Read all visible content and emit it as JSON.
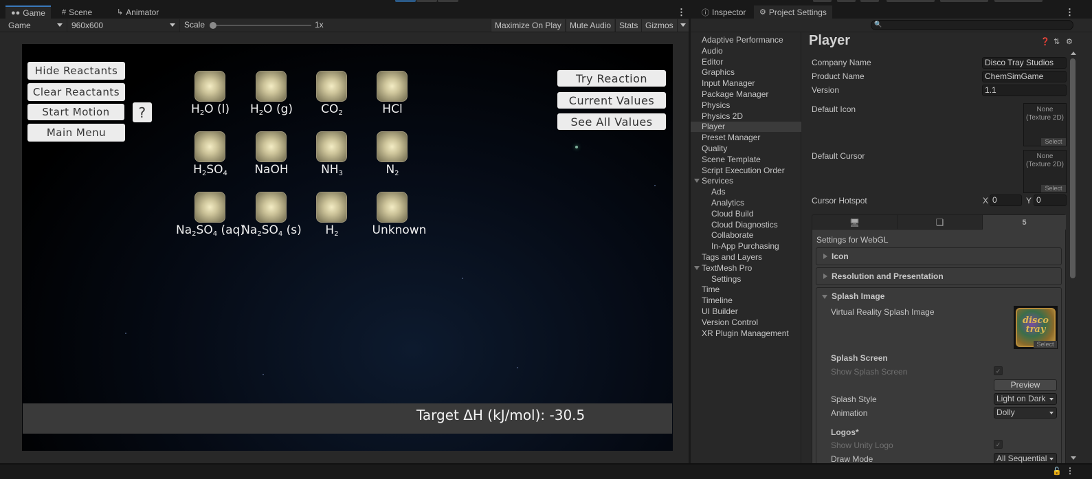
{
  "game_tabs": [
    {
      "label": "Game",
      "icon": "gamepad-icon",
      "active": true
    },
    {
      "label": "Scene",
      "icon": "grid-icon",
      "active": false
    },
    {
      "label": "Animator",
      "icon": "animator-icon",
      "active": false
    }
  ],
  "game_toolbar": {
    "display": "Game",
    "resolution": "960x600",
    "scale_label": "Scale",
    "scale_value": "1x",
    "maximize_on_play": "Maximize On Play",
    "mute_audio": "Mute Audio",
    "stats": "Stats",
    "gizmos": "Gizmos"
  },
  "game": {
    "left_buttons": [
      "Hide Reactants",
      "Clear Reactants",
      "Start Motion",
      "Main Menu"
    ],
    "help_button": "?",
    "right_buttons": [
      "Try Reaction",
      "Current Values",
      "See All Values"
    ],
    "reactants": [
      {
        "formula": "H|2|O (l)"
      },
      {
        "formula": "H|2|O (g)"
      },
      {
        "formula": "CO|2|"
      },
      {
        "formula": "HCl"
      },
      {
        "formula": "H|2|SO|4|"
      },
      {
        "formula": "NaOH"
      },
      {
        "formula": "NH|3|"
      },
      {
        "formula": "N|2|"
      },
      {
        "formula": "Na|2|SO|4| (aq)"
      },
      {
        "formula": "Na|2|SO|4| (s)"
      },
      {
        "formula": "H|2|"
      },
      {
        "formula": "Unknown"
      }
    ],
    "target_label": "Target ΔH (kJ/mol): -30.5"
  },
  "right_tabs": [
    {
      "label": "Inspector",
      "icon": "info-icon",
      "active": false
    },
    {
      "label": "Project Settings",
      "icon": "gear-icon",
      "active": true
    }
  ],
  "project_settings": {
    "search_placeholder": "",
    "nav": [
      {
        "label": "Adaptive Performance",
        "level": 0
      },
      {
        "label": "Audio",
        "level": 0
      },
      {
        "label": "Editor",
        "level": 0
      },
      {
        "label": "Graphics",
        "level": 0
      },
      {
        "label": "Input Manager",
        "level": 0
      },
      {
        "label": "Package Manager",
        "level": 0
      },
      {
        "label": "Physics",
        "level": 0
      },
      {
        "label": "Physics 2D",
        "level": 0
      },
      {
        "label": "Player",
        "level": 0,
        "selected": true
      },
      {
        "label": "Preset Manager",
        "level": 0
      },
      {
        "label": "Quality",
        "level": 0
      },
      {
        "label": "Scene Template",
        "level": 0
      },
      {
        "label": "Script Execution Order",
        "level": 0
      },
      {
        "label": "Services",
        "level": 0,
        "expanded": true
      },
      {
        "label": "Ads",
        "level": 1
      },
      {
        "label": "Analytics",
        "level": 1
      },
      {
        "label": "Cloud Build",
        "level": 1
      },
      {
        "label": "Cloud Diagnostics",
        "level": 1
      },
      {
        "label": "Collaborate",
        "level": 1
      },
      {
        "label": "In-App Purchasing",
        "level": 1
      },
      {
        "label": "Tags and Layers",
        "level": 0
      },
      {
        "label": "TextMesh Pro",
        "level": 0,
        "expanded": true
      },
      {
        "label": "Settings",
        "level": 1
      },
      {
        "label": "Time",
        "level": 0
      },
      {
        "label": "Timeline",
        "level": 0
      },
      {
        "label": "UI Builder",
        "level": 0
      },
      {
        "label": "Version Control",
        "level": 0
      },
      {
        "label": "XR Plugin Management",
        "level": 0
      }
    ],
    "player": {
      "title": "Player",
      "company_name_label": "Company Name",
      "company_name": "Disco Tray Studios",
      "product_name_label": "Product Name",
      "product_name": "ChemSimGame",
      "version_label": "Version",
      "version": "1.1",
      "default_icon_label": "Default Icon",
      "default_icon_value": "None (Texture 2D)",
      "default_cursor_label": "Default Cursor",
      "default_cursor_value": "None (Texture 2D)",
      "select_label": "Select",
      "cursor_hotspot_label": "Cursor Hotspot",
      "hotspot_x_label": "X",
      "hotspot_x": "0",
      "hotspot_y_label": "Y",
      "hotspot_y": "0",
      "platform_tabs": [
        {
          "icon": "desktop-icon",
          "active": false
        },
        {
          "icon": "windows-icon",
          "active": false
        },
        {
          "icon": "html5-icon",
          "active": true
        }
      ],
      "settings_for": "Settings for WebGL",
      "foldouts": [
        "Icon",
        "Resolution and Presentation",
        "Splash Image"
      ],
      "vr_splash_label": "Virtual Reality Splash Image",
      "vr_splash_image_text": "disco tray",
      "splash_screen_header": "Splash Screen",
      "show_splash_label": "Show Splash Screen",
      "show_splash_checked": true,
      "preview_button": "Preview",
      "splash_style_label": "Splash Style",
      "splash_style": "Light on Dark",
      "animation_label": "Animation",
      "animation": "Dolly",
      "logos_header": "Logos*",
      "show_unity_logo_label": "Show Unity Logo",
      "show_unity_logo_checked": true,
      "draw_mode_label": "Draw Mode",
      "draw_mode": "All Sequential"
    }
  }
}
